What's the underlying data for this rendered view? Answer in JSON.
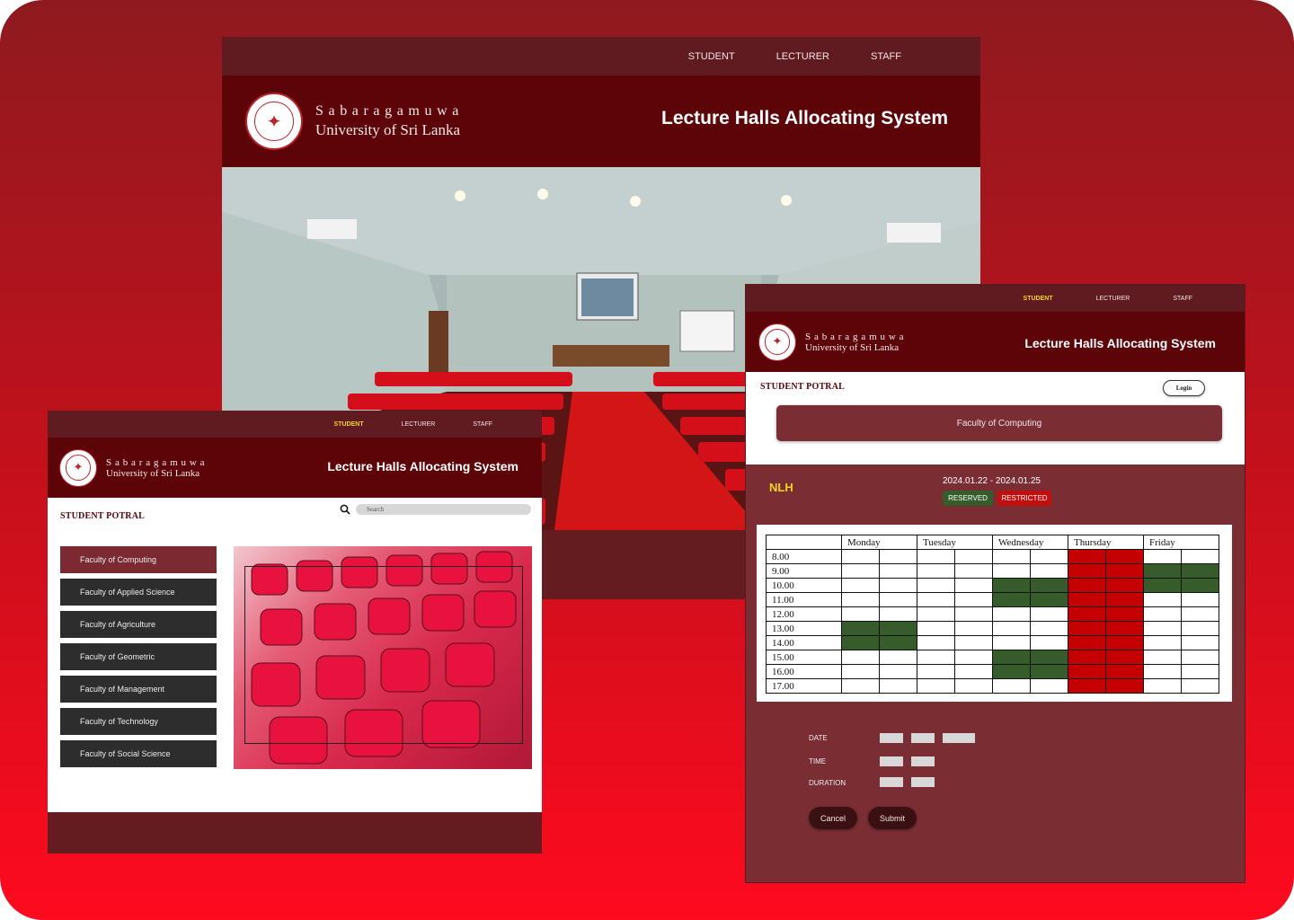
{
  "app": {
    "university_line1": "Sabaragamuwa",
    "university_line2": "University of Sri Lanka",
    "system_title": "Lecture Halls Allocating System"
  },
  "nav": {
    "items": [
      "STUDENT",
      "LECTURER",
      "STAFF"
    ],
    "active": "STUDENT"
  },
  "student_portal": {
    "label": "STUDENT POTRAL",
    "search_placeholder": "Search",
    "faculties": [
      "Faculty of Computing",
      "Faculty of Applied Science",
      "Faculty of Agriculture",
      "Faculty of Geometric",
      "Faculty of Management",
      "Faculty of Technology",
      "Faculty of Social Science"
    ],
    "active_faculty": "Faculty of Computing"
  },
  "schedule": {
    "login_label": "Login",
    "faculty": "Faculty of Computing",
    "hall": "NLH",
    "date_range": "2024.01.22 - 2024.01.25",
    "legend": {
      "reserved": "RESERVED",
      "restricted": "RESTRICTED"
    },
    "colors": {
      "reserved": "#355c2a",
      "restricted": "#c40000",
      "brand": "#5c0408",
      "active_nav": "#f3d321"
    },
    "days": [
      "Monday",
      "Tuesday",
      "Wednesday",
      "Thursday",
      "Friday"
    ],
    "times": [
      "8.00",
      "9.00",
      "10.00",
      "11.00",
      "12.00",
      "13.00",
      "14.00",
      "15.00",
      "16.00",
      "17.00"
    ],
    "grid": [
      [
        "",
        "",
        "",
        "",
        "",
        "",
        "R",
        "R",
        "",
        ""
      ],
      [
        "",
        "",
        "",
        "",
        "",
        "",
        "R",
        "R",
        "G",
        "G"
      ],
      [
        "",
        "",
        "",
        "",
        "G",
        "G",
        "R",
        "R",
        "G",
        "G"
      ],
      [
        "",
        "",
        "",
        "",
        "G",
        "G",
        "R",
        "R",
        "",
        ""
      ],
      [
        "",
        "",
        "",
        "",
        "",
        "",
        "R",
        "R",
        "",
        ""
      ],
      [
        "G",
        "G",
        "",
        "",
        "",
        "",
        "R",
        "R",
        "",
        ""
      ],
      [
        "G",
        "G",
        "",
        "",
        "",
        "",
        "R",
        "R",
        "",
        ""
      ],
      [
        "",
        "",
        "",
        "",
        "G",
        "G",
        "R",
        "R",
        "",
        ""
      ],
      [
        "",
        "",
        "",
        "",
        "G",
        "G",
        "R",
        "R",
        "",
        ""
      ],
      [
        "",
        "",
        "",
        "",
        "",
        "",
        "R",
        "R",
        "",
        ""
      ]
    ],
    "form": {
      "date_label": "DATE",
      "time_label": "TIME",
      "duration_label": "DURATION"
    },
    "cancel_label": "Cancel",
    "submit_label": "Submit"
  }
}
